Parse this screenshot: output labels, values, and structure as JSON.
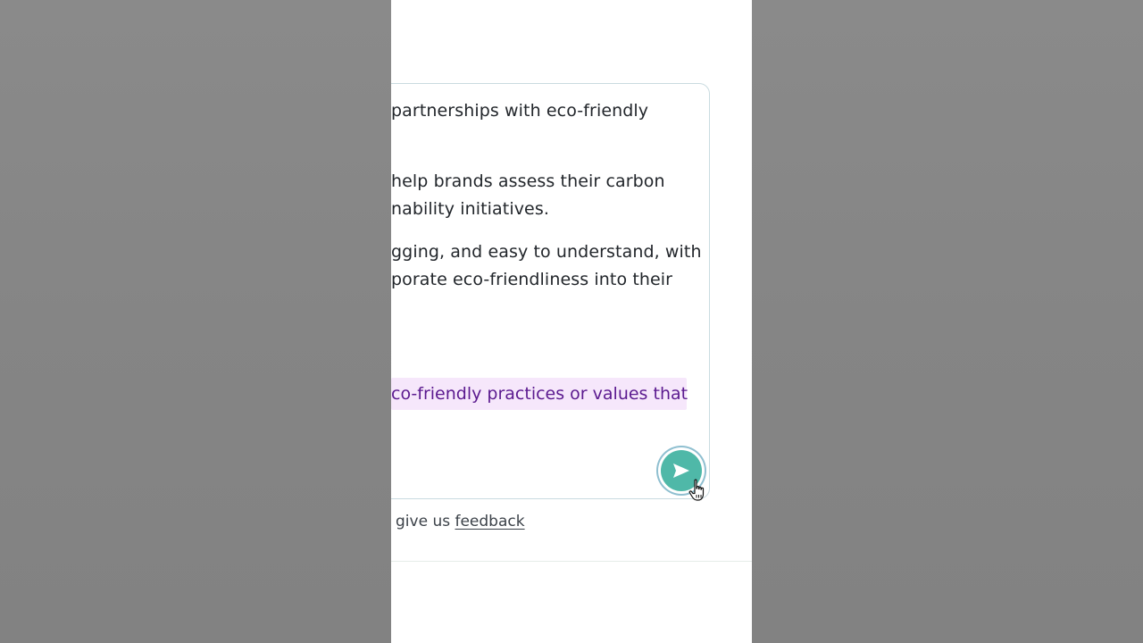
{
  "chat": {
    "lines": [
      "partnerships with eco-friendly",
      "help brands assess their carbon",
      "nability initiatives.",
      "gging, and easy to understand, with",
      "porate eco-friendliness into their"
    ],
    "highlighted_line": "co-friendly practices or values that"
  },
  "send_button": {
    "icon": "send-arrow-icon",
    "color": "#4fb8a8"
  },
  "footer": {
    "prefix": "give us ",
    "link_label": "feedback"
  },
  "colors": {
    "highlight_bg": "#f6e7fb",
    "highlight_text": "#5b1a8f",
    "accent": "#4fb8a8"
  }
}
